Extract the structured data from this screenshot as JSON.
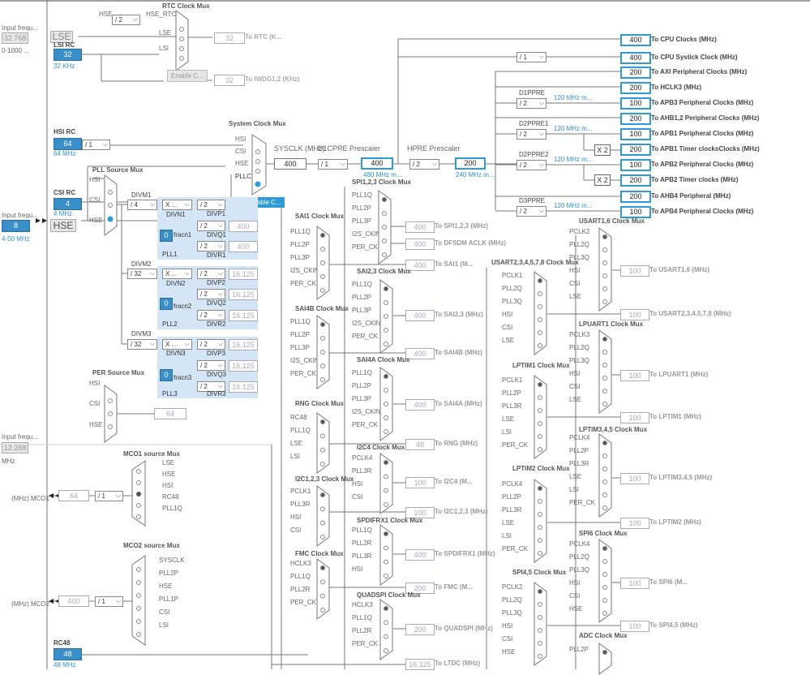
{
  "sources": {
    "input_freq_label": "Input frequ...",
    "lse_input": "32.768",
    "lse_range": "0-1000 ...",
    "lse_label": "LSE",
    "lsi_rc_label": "LSI RC",
    "lsi_value": "32",
    "lsi_freq": "32 KHz",
    "hsi_rc_label": "HSI RC",
    "hsi_value": "64",
    "hsi_freq": "64 MHz",
    "csi_rc_label": "CSI RC",
    "csi_value": "4",
    "csi_freq": "4 MHz",
    "hse_input_label": "Input frequ...",
    "hse_value": "8",
    "hse_label": "HSE",
    "hse_range": "4-50 MHz",
    "i2s_input_label": "Input frequ...",
    "i2s_value": "12.288",
    "i2s_unit": "MHz",
    "rc48_label": "RC48",
    "rc48_value": "48",
    "rc48_freq": "48 MHz"
  },
  "rtc": {
    "title": "RTC Clock Mux",
    "hse": "HSE",
    "div": "/ 2",
    "hse_rtc": "HSE_RTC",
    "lse": "LSE",
    "lsi": "LSI",
    "enable": "Enable C...",
    "rtc_value": "32",
    "rtc_to": "To RTC (K...",
    "iwdg_value": "32",
    "iwdg_to": "To IWDG1,2 (KHz)"
  },
  "hsi_div": "/ 1",
  "sysmux": {
    "title": "System Clock Mux",
    "hsi": "HSI",
    "csi": "CSI",
    "hse": "HSE",
    "pllclk": "PLLCLK",
    "enable": "Enable C...",
    "sysclk_label": "SYSCLK (MHz)",
    "sysclk_value": "400",
    "d1cpre_label": "D1CPRE Prescaler",
    "d1cpre_div": "/ 1",
    "d1cpre_value": "400",
    "d1cpre_note": "480 MHz m...",
    "hpre_label": "HPRE Prescaler",
    "hpre_div": "/ 2",
    "hpre_value": "200",
    "hpre_note": "240 MHz m..."
  },
  "pll": {
    "source_title": "PLL Source Mux",
    "hsi": "HSI",
    "csi": "CSI",
    "hse": "HSE",
    "divm1_label": "DIVM1",
    "divm1": "/ 4",
    "divn1": "X ...",
    "divn1_label": "DIVN1",
    "divp1": "/ 2",
    "divp1_label": "DIVP1",
    "divq1": "/ 2",
    "divq1_label": "DIVQ1",
    "divq1_value": "400",
    "divr1": "/ 2",
    "divr1_label": "DIVR1",
    "divr1_value": "400",
    "fracn1_value": "0",
    "fracn1_label": "fracn1",
    "pll1_label": "PLL1",
    "divm2_label": "DIVM2",
    "divm2": "/ 32",
    "divn2": "X ...",
    "divn2_label": "DIVN2",
    "divp2": "/ 2",
    "divp2_label": "DIVP2",
    "divp2_value": "16.125",
    "divq2": "/ 2",
    "divq2_label": "DIVQ2",
    "divq2_value": "16.125",
    "divr2": "/ 2",
    "divr2_label": "DIVR2",
    "divr2_value": "16.125",
    "fracn2_value": "0",
    "fracn2_label": "fracn2",
    "pll2_label": "PLL2",
    "divm3_label": "DIVM3",
    "divm3": "/ 32",
    "divn3": "X ...",
    "divn3_label": "DIVN3",
    "divp3": "/ 2",
    "divp3_label": "DIVP3",
    "divp3_value": "16.125",
    "divq3": "/ 2",
    "divq3_label": "DIVQ3",
    "divq3_value": "16.125",
    "divr3": "/ 2",
    "divr3_label": "DIVR3",
    "divr3_value": "16.125",
    "fracn3_value": "0",
    "fracn3_label": "fracn3",
    "pll3_label": "PLL3"
  },
  "per": {
    "title": "PER Source Mux",
    "hsi": "HSI",
    "csi": "CSI",
    "hse": "HSE",
    "value": "64"
  },
  "mco1": {
    "title": "MCO1 source Mux",
    "inputs": [
      "LSE",
      "HSE",
      "HSI",
      "RC48",
      "PLL1Q"
    ],
    "div": "/ 1",
    "value": "64",
    "label": "(MHz) MCO1"
  },
  "mco2": {
    "title": "MCO2 source Mux",
    "inputs": [
      "SYSCLK",
      "PLL2P",
      "HSE",
      "PLL1P",
      "CSI",
      "LSI"
    ],
    "div": "/ 1",
    "value": "400",
    "label": "(MHz) MCO2"
  },
  "outputs": [
    {
      "value": "400",
      "label": "To CPU Clocks (MHz)"
    },
    {
      "value": "400",
      "label": "To CPU Systick Clock (MHz)"
    },
    {
      "value": "200",
      "label": "To AXI Peripheral Clocks (MHz)"
    },
    {
      "value": "200",
      "label": "To HCLK3 (MHz)"
    },
    {
      "value": "100",
      "label": "To APB3 Peripheral Clocks (MHz)"
    },
    {
      "value": "200",
      "label": "To AHB1,2 Peripheral Clocks (MHz)"
    },
    {
      "value": "100",
      "label": "To APB1 Peripheral Clocks (MHz)"
    },
    {
      "value": "200",
      "label": "To APB1 Timer clocksClocks (MHz)"
    },
    {
      "value": "100",
      "label": "To APB2 Peripheral Clocks (MHz)"
    },
    {
      "value": "200",
      "label": "To APB2 Timer clocks (MHz)"
    },
    {
      "value": "200",
      "label": "To AHB4 Peripheral (MHz)"
    },
    {
      "value": "100",
      "label": "To APB4 Peripheral Clocks (MHz)"
    }
  ],
  "systick_div": "/ 1",
  "prescalers": {
    "d1ppre_label": "D1PPRE",
    "d1ppre": "/ 2",
    "d1ppre_note": "120 MHz m...",
    "d2ppre1_label": "D2PPRE1",
    "d2ppre1": "/ 2",
    "d2ppre1_note": "120 MHz m...",
    "d2ppre2_label": "D2PPRE2",
    "d2ppre2": "/ 2",
    "d2ppre2_note": "120 MHz m...",
    "d3ppre_label": "D3PPRE",
    "d3ppre": "/ 2",
    "d3ppre_note": "120 MHz m...",
    "x2": "X 2"
  },
  "periph_muxes": [
    {
      "id": "spi123",
      "title": "SPI1,2,3 Clock Mux",
      "inputs": [
        "PLL1Q",
        "PLL2P",
        "PLL3P",
        "I2S_CKIN",
        "PER_CK"
      ],
      "outs": [
        {
          "value": "400",
          "label": "To SPI1,2,3 (MHz)"
        },
        {
          "value": "400",
          "label": "To DFSDM ACLK (MHz)"
        }
      ]
    },
    {
      "id": "sai1",
      "title": "SAI1 Clock Mux",
      "inputs": [
        "PLL1Q",
        "PLL2P",
        "PLL3P",
        "I2S_CKIN",
        "PER_CK"
      ],
      "outs": [
        {
          "value": "400",
          "label": "To SAI1 (M..."
        }
      ]
    },
    {
      "id": "sai23",
      "title": "SAI2,3 Clock Mux",
      "inputs": [
        "PLL1Q",
        "PLL2P",
        "PLL3P",
        "I2S_CKIN",
        "PER_CK"
      ],
      "outs": [
        {
          "value": "400",
          "label": "To SAI2,3 (MHz)"
        }
      ]
    },
    {
      "id": "sai4b",
      "title": "SAI4B Clock Mux",
      "inputs": [
        "PLL1Q",
        "PLL2P",
        "PLL3P",
        "I2S_CKIN",
        "PER_CK"
      ],
      "outs": [
        {
          "value": "400",
          "label": "To SAI4B (MHz)"
        }
      ]
    },
    {
      "id": "sai4a",
      "title": "SAI4A Clock Mux",
      "inputs": [
        "PLL1Q",
        "PLL2P",
        "PLL3P",
        "I2S_CKIN",
        "PER_CK"
      ],
      "outs": [
        {
          "value": "400",
          "label": "To SAI4A (MHz)"
        }
      ]
    },
    {
      "id": "rng",
      "title": "RNG Clock Mux",
      "inputs": [
        "RC48",
        "PLL1Q",
        "LSE",
        "LSI"
      ],
      "outs": [
        {
          "value": "48",
          "label": "To RNG (MHz)"
        }
      ]
    },
    {
      "id": "i2c4",
      "title": "I2C4 Clock Mux",
      "inputs": [
        "PCLK4",
        "PLL3R",
        "HSI",
        "CSI"
      ],
      "outs": [
        {
          "value": "100",
          "label": "To I2C4 (M..."
        }
      ]
    },
    {
      "id": "i2c123",
      "title": "I2C1,2,3 Clock Mux",
      "inputs": [
        "PCLK1",
        "PLL3R",
        "HSI",
        "CSI"
      ],
      "outs": [
        {
          "value": "100",
          "label": "To I2C1,2,3 (MHz)"
        }
      ]
    },
    {
      "id": "spdif",
      "title": "SPDIFRX1 Clock Mux",
      "inputs": [
        "PLL1Q",
        "PLL2R",
        "PLL3R",
        "HSI"
      ],
      "outs": [
        {
          "value": "400",
          "label": "To SPDIFRX1 (MHz)"
        }
      ]
    },
    {
      "id": "fmc",
      "title": "FMC Clock Mux",
      "inputs": [
        "HCLK3",
        "PLL1Q",
        "PLL2R",
        "PER_CK"
      ],
      "outs": [
        {
          "value": "200",
          "label": "To FMC (M..."
        }
      ]
    },
    {
      "id": "qspi",
      "title": "QUADSPI Clock Mux",
      "inputs": [
        "HCLK3",
        "PLL1Q",
        "PLL2R",
        "PER_CK"
      ],
      "outs": [
        {
          "value": "200",
          "label": "To QUADSPI (MHz)"
        }
      ]
    },
    {
      "id": "ltdc",
      "title": "",
      "inputs": [],
      "outs": [
        {
          "value": "16.125",
          "label": "To LTDC (MHz)"
        }
      ]
    },
    {
      "id": "usart16",
      "title": "USART1,6 Clock Mux",
      "inputs": [
        "PCLK2",
        "PLL2Q",
        "PLL3Q",
        "HSI",
        "CSI",
        "LSE"
      ],
      "outs": [
        {
          "value": "100",
          "label": "To USART1,6 (MHz)"
        }
      ]
    },
    {
      "id": "usart2",
      "title": "USART2,3,4,5,7,8 Clock Mux",
      "inputs": [
        "PCLK1",
        "PLL2Q",
        "PLL3Q",
        "HSI",
        "CSI",
        "LSE"
      ],
      "outs": [
        {
          "value": "100",
          "label": "To USART2,3,4,5,7,8 (MHz)"
        }
      ]
    },
    {
      "id": "lpuart1",
      "title": "LPUART1 Clock Mux",
      "inputs": [
        "PCLK3",
        "PLL2Q",
        "PLL3Q",
        "HSI",
        "CSI",
        "LSE"
      ],
      "outs": [
        {
          "value": "100",
          "label": "To LPUART1 (MHz)"
        }
      ]
    },
    {
      "id": "lptim1",
      "title": "LPTIM1 Clock Mux",
      "inputs": [
        "PCLK1",
        "PLL2P",
        "PLL3R",
        "LSE",
        "LSI",
        "PER_CK"
      ],
      "outs": [
        {
          "value": "100",
          "label": "To LPTIM1 (MHz)"
        }
      ]
    },
    {
      "id": "lptim345",
      "title": "LPTIM3,4,5 Clock Mux",
      "inputs": [
        "PCLK4",
        "PLL2P",
        "PLL3R",
        "LSE",
        "LSI",
        "PER_CK"
      ],
      "outs": [
        {
          "value": "100",
          "label": "To LPTIM3,4,5 (MHz)"
        }
      ]
    },
    {
      "id": "lptim2",
      "title": "LPTIM2 Clock Mux",
      "inputs": [
        "PCLK4",
        "PLL2P",
        "PLL3R",
        "LSE",
        "LSI",
        "PER_CK"
      ],
      "outs": [
        {
          "value": "100",
          "label": "To LPTIM2 (MHz)"
        }
      ]
    },
    {
      "id": "spi6",
      "title": "SPI6 Clock Mux",
      "inputs": [
        "PCLK4",
        "PLL2Q",
        "PLL3Q",
        "HSI",
        "CSI",
        "HSE"
      ],
      "outs": [
        {
          "value": "100",
          "label": "To SPI6 (M..."
        }
      ]
    },
    {
      "id": "spi45",
      "title": "SPI4,5 Clock Mux",
      "inputs": [
        "PCLK2",
        "PLL2Q",
        "PLL3Q",
        "HSI",
        "CSI",
        "HSE"
      ],
      "outs": [
        {
          "value": "100",
          "label": "To SPI4,5 (MHz)"
        }
      ]
    },
    {
      "id": "adc",
      "title": "ADC Clock Mux",
      "inputs": [
        "PLL2P"
      ],
      "outs": []
    }
  ]
}
